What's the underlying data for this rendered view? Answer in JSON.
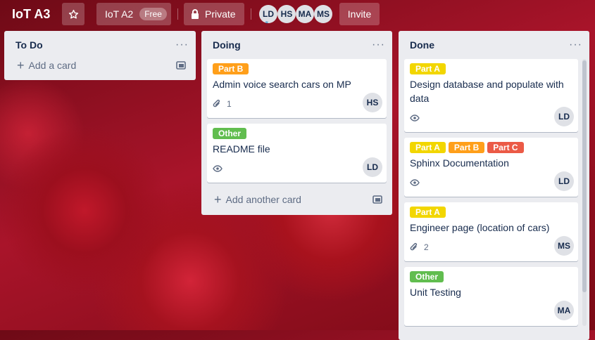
{
  "header": {
    "board_title": "IoT A3",
    "team_name": "IoT A2",
    "team_badge": "Free",
    "visibility": "Private",
    "invite_label": "Invite",
    "members": [
      "LD",
      "HS",
      "MA",
      "MS"
    ],
    "admin_marker": "≈"
  },
  "icons": {
    "star": "star-icon",
    "lock": "lock-icon",
    "menu": "ellipsis-icon",
    "attachment": "paperclip-icon",
    "watch": "eye-icon",
    "template": "card-template-icon",
    "add": "plus-icon"
  },
  "lists": [
    {
      "title": "To Do",
      "menu": "···",
      "add_label": "Add a card",
      "cards": []
    },
    {
      "title": "Doing",
      "menu": "···",
      "add_label": "Add another card",
      "cards": [
        {
          "labels": [
            {
              "text": "Part B",
              "color": "#ff9f1a"
            }
          ],
          "title": "Admin voice search cars on MP",
          "attachments": "1",
          "member": "HS"
        },
        {
          "labels": [
            {
              "text": "Other",
              "color": "#61bd4f"
            }
          ],
          "title": "README file",
          "watching": true,
          "member": "LD"
        }
      ]
    },
    {
      "title": "Done",
      "menu": "···",
      "cards": [
        {
          "labels": [
            {
              "text": "Part A",
              "color": "#f2d600"
            }
          ],
          "title": "Design database and populate with data",
          "watching": true,
          "member": "LD"
        },
        {
          "labels": [
            {
              "text": "Part A",
              "color": "#f2d600"
            },
            {
              "text": "Part B",
              "color": "#ff9f1a"
            },
            {
              "text": "Part C",
              "color": "#eb5a46"
            }
          ],
          "title": "Sphinx Documentation",
          "watching": true,
          "member": "LD"
        },
        {
          "labels": [
            {
              "text": "Part A",
              "color": "#f2d600"
            }
          ],
          "title": "Engineer page (location of cars)",
          "attachments": "2",
          "member": "MS"
        },
        {
          "labels": [
            {
              "text": "Other",
              "color": "#61bd4f"
            }
          ],
          "title": "Unit Testing",
          "member": "MA"
        }
      ]
    }
  ]
}
